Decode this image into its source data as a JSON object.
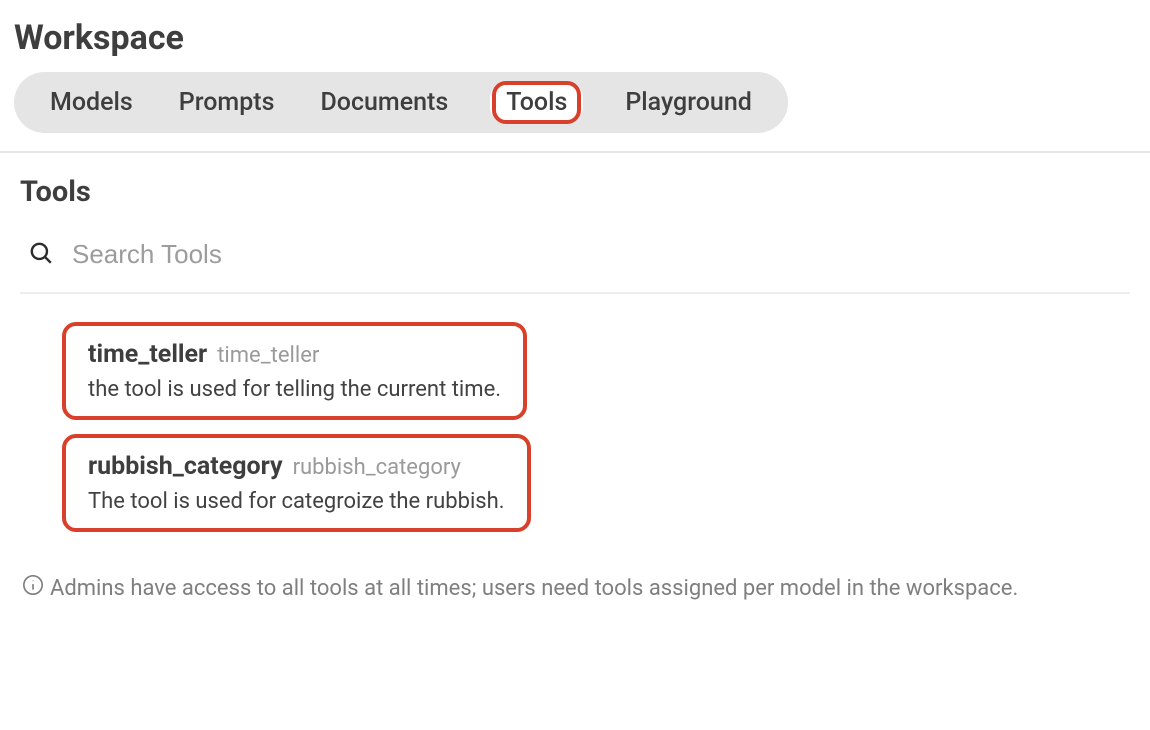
{
  "header": {
    "title": "Workspace",
    "tabs": [
      {
        "label": "Models"
      },
      {
        "label": "Prompts"
      },
      {
        "label": "Documents"
      },
      {
        "label": "Tools"
      },
      {
        "label": "Playground"
      }
    ]
  },
  "section": {
    "title": "Tools",
    "search_placeholder": "Search Tools"
  },
  "tools": [
    {
      "name": "time_teller",
      "slug": "time_teller",
      "description": "the tool is used for telling the current time."
    },
    {
      "name": "rubbish_category",
      "slug": "rubbish_category",
      "description": "The tool is used for categroize the rubbish."
    }
  ],
  "footer_note": "Admins have access to all tools at all times; users need tools assigned per model in the workspace."
}
